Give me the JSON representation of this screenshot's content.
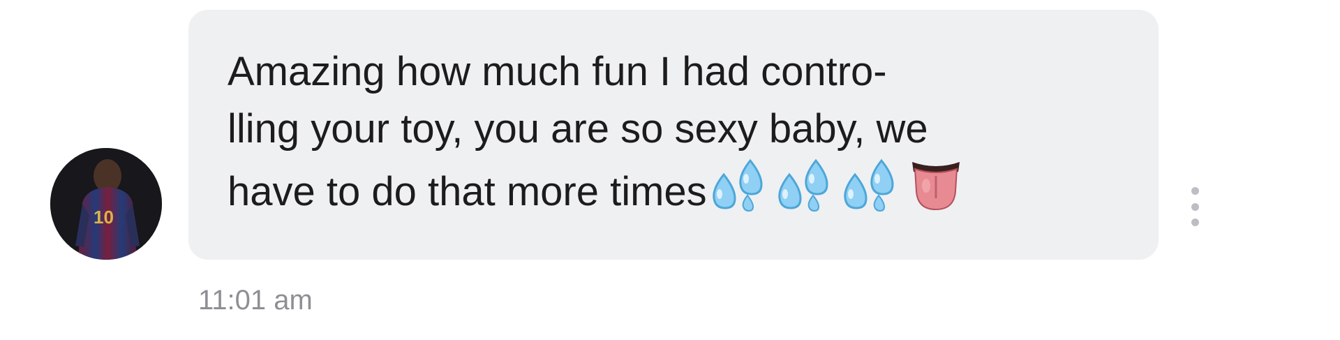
{
  "message": {
    "lines": [
      "Amazing how much fun I had contro-",
      "lling your toy, you are so sexy baby, we",
      "have to do that more times"
    ],
    "emojis": [
      "sweat-droplets-icon",
      "sweat-droplets-icon",
      "sweat-droplets-icon",
      "tongue-icon"
    ],
    "timestamp": "11:01 am"
  },
  "avatar": {
    "jersey_number": "10"
  },
  "colors": {
    "bubble_background": "#eff0f2",
    "message_text": "#1c1c1c",
    "timestamp_text": "#8e8f94",
    "menu_dots": "#bdbec3",
    "droplet_blue": "#8fd0f4",
    "tongue_pink": "#e88a92"
  }
}
